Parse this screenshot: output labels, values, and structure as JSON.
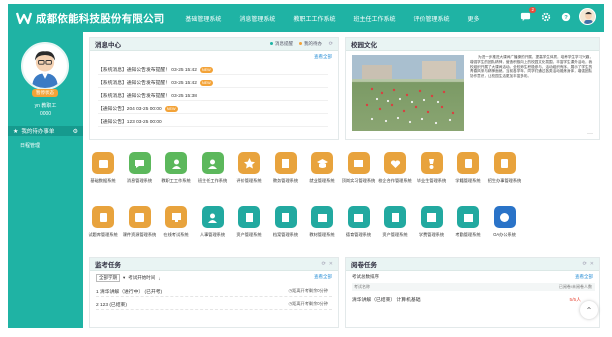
{
  "app": {
    "title": "成都依能科技股份有限公司"
  },
  "nav": [
    "基础管理系统",
    "消息管理系统",
    "教职工工作系统",
    "班主任工作系统",
    "评价管理系统",
    "更多"
  ],
  "topbar": {
    "message_count": "2"
  },
  "profile": {
    "status": "暂停状态",
    "name": "yn  教职工",
    "id": "0000"
  },
  "sidebar": {
    "menu_main": "我的待办事单",
    "menu_sub": "日程管理"
  },
  "news": {
    "title": "消息中心",
    "tab1": "消息提醒",
    "tab2": "我的待办",
    "more": "查看全部",
    "rows": [
      {
        "text": "【系统消息】通知公告发布提醒！  03-25 15:42",
        "tag": "NEW"
      },
      {
        "text": "【系统消息】通知公告发布提醒！  03-25 15:42",
        "tag": "NEW"
      },
      {
        "text": "【系统消息】通知公告发布提醒！  03-25 15:38",
        "tag": ""
      },
      {
        "text": "【通知公告】204   03-25 00:00",
        "tag": "NEW"
      },
      {
        "text": "【通知公告】123   03-25 00:00",
        "tag": ""
      }
    ]
  },
  "culture": {
    "title": "校园文化",
    "text": "为进一步推进大课间广播操的开展，提高学生体质，培养学生学习兴趣，增强学生的团队精神，营造积极向上的校园文化氛围，丰富学生课外活动，我校组织开展了大课间活动。全校师生积极参与，活动组织有序，展示了学生的青春风采与精神面貌。当前各学年，同学们通过各类活动锻炼身体，增强团队协作意识，让校园生活更加丰富多彩。",
    "more": "···"
  },
  "apps": [
    {
      "label": "基础数据系统",
      "color": "#e8a33d"
    },
    {
      "label": "消息管理系统",
      "color": "#5cb85c"
    },
    {
      "label": "教职工工作系统",
      "color": "#5cb85c"
    },
    {
      "label": "班主任工作系统",
      "color": "#5cb85c"
    },
    {
      "label": "评价管理系统",
      "color": "#e8a33d"
    },
    {
      "label": "教务管理系统",
      "color": "#e8a33d"
    },
    {
      "label": "就业管理系统",
      "color": "#e8a33d"
    },
    {
      "label": "顶岗实习管理系统",
      "color": "#e8a33d"
    },
    {
      "label": "校企合作管理系统",
      "color": "#e8a33d"
    },
    {
      "label": "毕业生管理系统",
      "color": "#e8a33d"
    },
    {
      "label": "学籍管理系统",
      "color": "#e8a33d"
    },
    {
      "label": "招生办事管理系统",
      "color": "#e8a33d"
    },
    {
      "label": "试题库管理系统",
      "color": "#e8a33d"
    },
    {
      "label": "课件资源管理系统",
      "color": "#e8a33d"
    },
    {
      "label": "在线考试系统",
      "color": "#e8a33d"
    },
    {
      "label": "人事管理系统",
      "color": "#22a9a0"
    },
    {
      "label": "资产管理系统",
      "color": "#22a9a0"
    },
    {
      "label": "档案管理系统",
      "color": "#22a9a0"
    },
    {
      "label": "教材管理系统",
      "color": "#22a9a0"
    },
    {
      "label": "德育管理系统",
      "color": "#22a9a0"
    },
    {
      "label": "资产管理系统",
      "color": "#22a9a0"
    },
    {
      "label": "学费管理系统",
      "color": "#22a9a0"
    },
    {
      "label": "考勤管理系统",
      "color": "#22a9a0"
    },
    {
      "label": "OA办公系统",
      "color": "#2a73c8"
    }
  ],
  "exam": {
    "title": "监考任务",
    "filter_term": "全部学期",
    "filter_sort": "考试开始时间",
    "more": "查看全部",
    "rows": [
      {
        "text": "1  清华讲解（进行中）  (已开考)",
        "right": "距离开考剩余0分钟"
      },
      {
        "text": "2  123  (已结束)",
        "right": "距离开考剩余0分钟"
      }
    ]
  },
  "review": {
    "title": "阅卷任务",
    "count_label": "考试总数排序",
    "more": "查看全部",
    "col_name": "考试名称",
    "col_count": "已阅卷/未阅卷人数",
    "row_name": "清华讲解（已结束）  计算机基础",
    "row_value": "5/5人"
  }
}
